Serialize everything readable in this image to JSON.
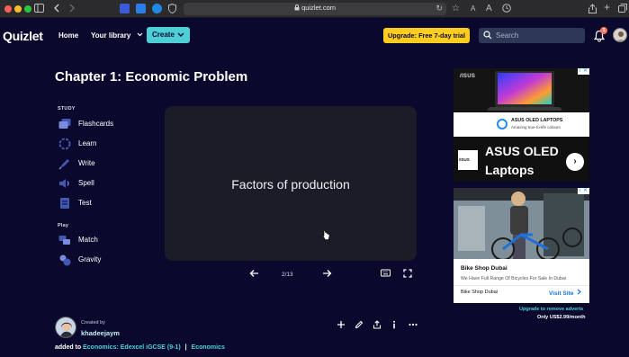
{
  "browser": {
    "url": "quizlet.com"
  },
  "header": {
    "logo": "Quizlet",
    "nav": {
      "home": "Home",
      "your_library": "Your library"
    },
    "create_label": "Create",
    "upgrade_label": "Upgrade: Free 7-day trial",
    "search_placeholder": "Search",
    "notification_count": "1"
  },
  "set": {
    "title": "Chapter 1: Economic Problem",
    "study_label": "STUDY",
    "play_label": "Play",
    "study_modes": [
      "Flashcards",
      "Learn",
      "Write",
      "Spell",
      "Test"
    ],
    "play_modes": [
      "Match",
      "Gravity"
    ]
  },
  "flashcard": {
    "term": "Factors of production",
    "counter": "2/13"
  },
  "creator": {
    "created_by_label": "Created by",
    "name": "khadeejaym",
    "added_to_label": "added to",
    "folder": "Economics: Edexcel iGCSE (9-1)",
    "class_link": "Economics"
  },
  "ads": {
    "ad1": {
      "brand": "/ISUS",
      "headline_small": "ASUS OLED LAPTOPS",
      "sub_small": "Amazing true-to-life colours",
      "logo_text": "/ISUS",
      "big_text": [
        "ASUS OLED",
        "Laptops"
      ]
    },
    "ad2": {
      "title": "Bike Shop Dubai",
      "description": "We Have Full Range Of Bicycles For Sale In Dubai",
      "advertiser": "Bike Shop Dubai",
      "cta": "Visit Site"
    },
    "remove_ads": "Upgrade to remove adverts",
    "price": "Only US$2.99/month"
  },
  "colors": {
    "background": "#0a092d",
    "accent_teal": "#4ecfd6",
    "upgrade_yellow": "#ffcd1f",
    "card": "#1c1c28",
    "mode_blue": "#4257b2"
  }
}
